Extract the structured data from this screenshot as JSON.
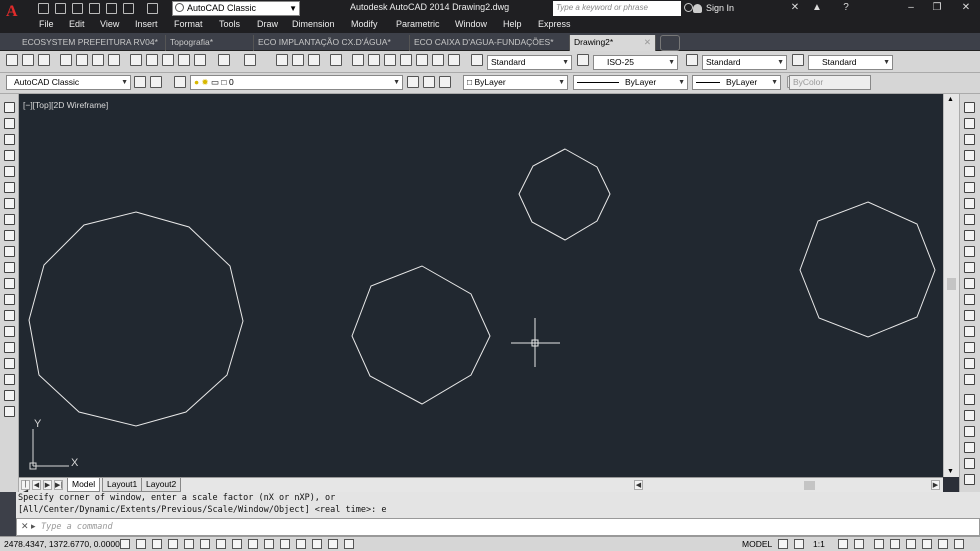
{
  "titlebar": {
    "workspace": "AutoCAD Classic",
    "app_title": "Autodesk AutoCAD 2014    Drawing2.dwg",
    "search_placeholder": "Type a keyword or phrase",
    "sign_in": "Sign In",
    "help": "?",
    "minimize": "–",
    "restore": "❐",
    "close": "✕"
  },
  "menu": [
    "File",
    "Edit",
    "View",
    "Insert",
    "Format",
    "Tools",
    "Draw",
    "Dimension",
    "Modify",
    "Parametric",
    "Window",
    "Help",
    "Express"
  ],
  "doc_tabs": [
    {
      "label": "ECOSYSTEM PREFEITURA RV04*"
    },
    {
      "label": "Topografia*"
    },
    {
      "label": "ECO IMPLANTAÇÃO CX.D'ÁGUA*"
    },
    {
      "label": "ECO CAIXA D'AGUA-FUNDAÇÕES*"
    },
    {
      "label": "Drawing2*"
    }
  ],
  "toolbar1": {
    "text_style": "Standard",
    "dim_style": "ISO-25",
    "table_style": "Standard",
    "multileader_style": "Standard"
  },
  "toolbar2": {
    "workspace": "AutoCAD Classic",
    "layer": "0",
    "color": "ByLayer",
    "linetype": "ByLayer",
    "lineweight": "ByLayer",
    "plotstyle": "ByColor"
  },
  "viewport_label": "[−][Top][2D Wireframe]",
  "ucs": {
    "x": "X",
    "y": "Y"
  },
  "layout_tabs": [
    "Model",
    "Layout1",
    "Layout2"
  ],
  "command": {
    "line1": "Specify corner of window, enter a scale factor (nX or nXP), or",
    "line2": "[All/Center/Dynamic/Extents/Previous/Scale/Window/Object] <real time>: e",
    "placeholder": "Type a command"
  },
  "status": {
    "coords": "2478.4347, 1372.6770, 0.0000",
    "model": "MODEL",
    "scale": "1:1"
  },
  "colors": {
    "canvas_bg": "#212830",
    "geometry": "#e8e8e8",
    "title_bg": "#1f1f22"
  }
}
